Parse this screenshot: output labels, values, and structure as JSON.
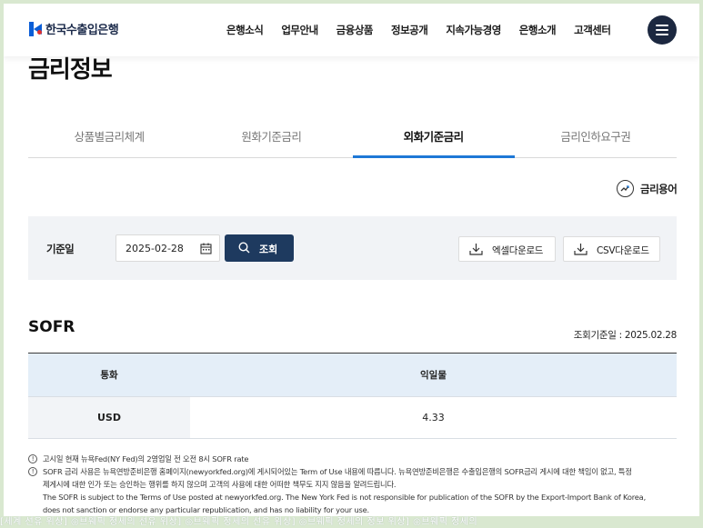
{
  "header": {
    "logo_text": "한국수출입은행",
    "nav": [
      "은행소식",
      "업무안내",
      "금융상품",
      "정보공개",
      "지속가능경영",
      "은행소개",
      "고객센터"
    ]
  },
  "page_title": "금리정보",
  "tabs": [
    {
      "label": "상품별금리체계",
      "active": false
    },
    {
      "label": "원화기준금리",
      "active": false
    },
    {
      "label": "외화기준금리",
      "active": true
    },
    {
      "label": "금리인하요구권",
      "active": false
    }
  ],
  "glossary_label": "금리용어",
  "search": {
    "date_label": "기준일",
    "date_value": "2025-02-28",
    "search_label": "조회",
    "excel_label": "엑셀다운로드",
    "csv_label": "CSV다운로드"
  },
  "section": {
    "title": "SOFR",
    "ref_date": "조회기준일 : 2025.02.28"
  },
  "table": {
    "headers": [
      "통화",
      "익일물"
    ],
    "rows": [
      {
        "currency": "USD",
        "overnight": "4.33"
      }
    ]
  },
  "notes": {
    "line1": "고시일 현재 뉴욕Fed(NY Fed)의 2영업일 전 오전 8시 SOFR rate",
    "line2": "SOFR 금리 사용은 뉴욕연방준비은행 홈페이지(newyorkfed.org)에 게시되어있는 Term of Use 내용에 따릅니다. 뉴욕연방준비은행은 수출입은행의 SOFR금리 게시에 대한 책임이 없고, 특정",
    "line3": "제게시에 대한 인가 또는 승인하는 행위를 하지 않으며 고객의 사용에 대한 어떠한 책무도 지지 않음을 알려드립니다.",
    "line4": "The SOFR is subject to the Terms of Use posted at newyorkfed.org. The New York Fed is not responsible for publication of the SOFR by the Export-Import Bank of Korea,",
    "line5": "does not sanction or endorse any particular republication, and has no liability for your use."
  },
  "ticker_text": "[세계 선유 위상]  ◎브웨픽 정세의 선유 위상]   ◎브웨픽 정세의 선유 위상]   ◎브웨픽 정세의 정보 위상]   ◎브웨픽 정세의"
}
